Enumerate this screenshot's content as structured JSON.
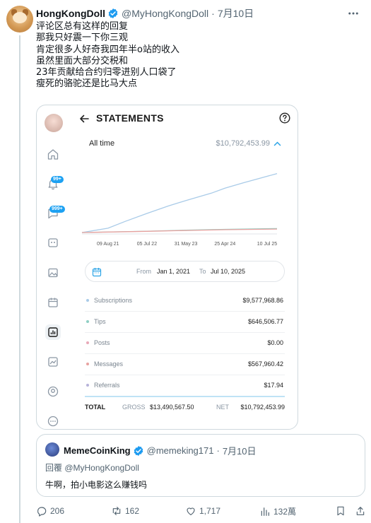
{
  "tweet": {
    "author_name": "HongKongDoll",
    "author_handle": "@MyHongKongDoll",
    "separator": "·",
    "date": "7月10日",
    "lines": [
      "评论区总有这样的回复",
      "那我只好震一下你三观",
      "肯定很多人好奇我四年半o站的收入",
      "虽然里面大部分交税和",
      "23年贡献给合约归零进别人口袋了",
      "瘦死的骆驼还是比马大点"
    ]
  },
  "screenshot": {
    "title": "STATEMENTS",
    "badges": {
      "notifications": "99+",
      "messages": "999+"
    },
    "period_label": "All time",
    "period_total": "$10,792,453.99",
    "range": {
      "from_label": "From",
      "from_date": "Jan 1, 2021",
      "to_label": "To",
      "to_date": "Jul 10, 2025"
    },
    "rows": [
      {
        "label": "Subscriptions",
        "value": "$9,577,968.86",
        "color": "#a9cbe8"
      },
      {
        "label": "Tips",
        "value": "$646,506.77",
        "color": "#8fcfc4"
      },
      {
        "label": "Posts",
        "value": "$0.00",
        "color": "#e8a8b8"
      },
      {
        "label": "Messages",
        "value": "$567,960.42",
        "color": "#e8a2a0"
      },
      {
        "label": "Referrals",
        "value": "$17.94",
        "color": "#b7b3d9"
      }
    ],
    "totals": {
      "total_label": "TOTAL",
      "gross_label": "GROSS",
      "gross": "$13,490,567.50",
      "net_label": "NET",
      "net": "$10,792,453.99"
    }
  },
  "chart_data": {
    "type": "line",
    "x_ticks": [
      "09 Aug 21",
      "05 Jul 22",
      "31 May 23",
      "25 Apr 24",
      "10 Jul 25"
    ],
    "x_range": [
      "2021-01-01",
      "2025-07-10"
    ],
    "series": [
      {
        "name": "Subscriptions",
        "color": "#a9cbe8",
        "x": [
          "2021-01-01",
          "2021-08-09",
          "2022-01-01",
          "2022-07-05",
          "2023-01-01",
          "2023-05-31",
          "2024-01-01",
          "2024-04-25",
          "2024-10-01",
          "2025-07-10"
        ],
        "y": [
          0,
          700000,
          1800000,
          3100000,
          4300000,
          5200000,
          6400000,
          7200000,
          8100000,
          9577969
        ]
      },
      {
        "name": "Tips",
        "color": "#8fcfc4",
        "x": [
          "2021-01-01",
          "2022-07-05",
          "2023-05-31",
          "2024-04-25",
          "2025-07-10"
        ],
        "y": [
          0,
          220000,
          380000,
          520000,
          646507
        ]
      },
      {
        "name": "Messages",
        "color": "#e8a2a0",
        "x": [
          "2021-01-01",
          "2022-07-05",
          "2023-05-31",
          "2024-04-25",
          "2025-07-10"
        ],
        "y": [
          0,
          200000,
          330000,
          460000,
          567960
        ]
      }
    ],
    "ylim": [
      0,
      10792454
    ],
    "grid": false,
    "legend": "none"
  },
  "quote": {
    "author_name": "MemeCoinKing",
    "author_handle": "@memeking171",
    "separator": "·",
    "date": "7月10日",
    "reply_to": "回覆 @MyHongKongDoll",
    "text": "牛啊，拍小电影这么赚钱吗"
  },
  "actions": {
    "replies": "206",
    "retweets": "162",
    "likes": "1,717",
    "views": "132萬"
  },
  "colors": {
    "verified": "#1d9bf0",
    "accent": "#1da1f2",
    "muted": "#536471"
  }
}
